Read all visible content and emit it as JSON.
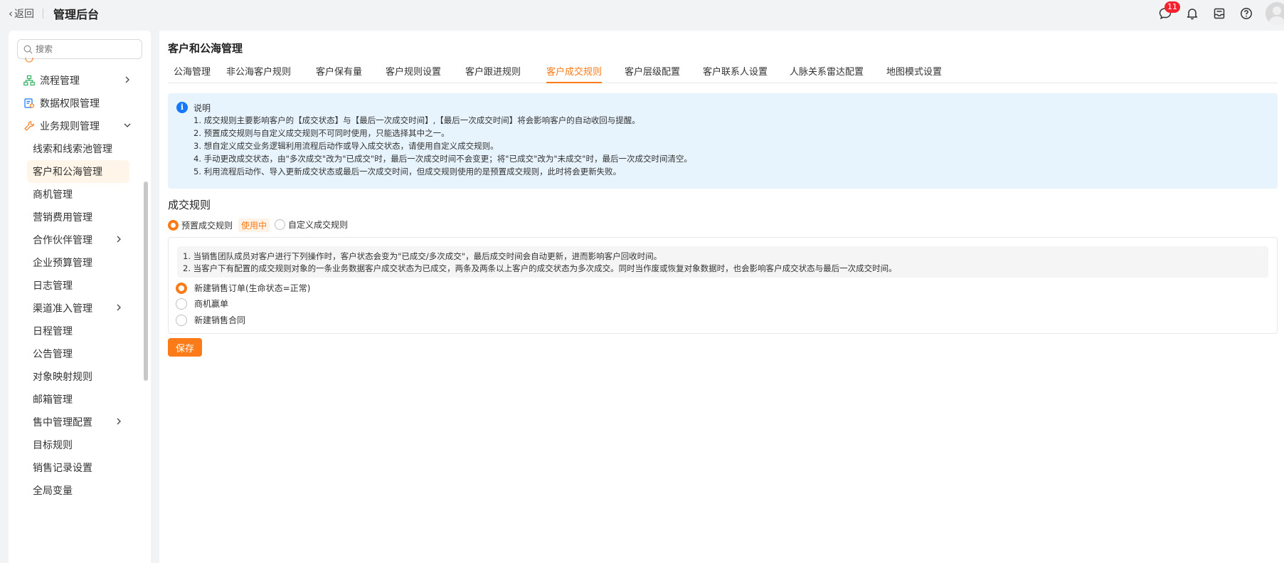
{
  "topbar": {
    "back_label": "返回",
    "app_title": "管理后台",
    "message_badge": "11"
  },
  "sidebar": {
    "search_placeholder": "搜索",
    "items": [
      {
        "label": "流程管理",
        "icon": "flow-icon",
        "level": 1,
        "expandable": true
      },
      {
        "label": "数据权限管理",
        "icon": "data-permission-icon",
        "level": 1,
        "expandable": false
      },
      {
        "label": "业务规则管理",
        "icon": "wrench-icon",
        "level": 1,
        "expandable": true,
        "expanded": true
      },
      {
        "label": "线索和线索池管理",
        "level": 2
      },
      {
        "label": "客户和公海管理",
        "level": 2,
        "active": true
      },
      {
        "label": "商机管理",
        "level": 2
      },
      {
        "label": "营销费用管理",
        "level": 2
      },
      {
        "label": "合作伙伴管理",
        "level": 2,
        "expandable": true
      },
      {
        "label": "企业预算管理",
        "level": 2
      },
      {
        "label": "日志管理",
        "level": 2
      },
      {
        "label": "渠道准入管理",
        "level": 2,
        "expandable": true
      },
      {
        "label": "日程管理",
        "level": 2
      },
      {
        "label": "公告管理",
        "level": 2
      },
      {
        "label": "对象映射规则",
        "level": 2
      },
      {
        "label": "邮箱管理",
        "level": 2
      },
      {
        "label": "售中管理配置",
        "level": 2,
        "expandable": true
      },
      {
        "label": "目标规则",
        "level": 2
      },
      {
        "label": "销售记录设置",
        "level": 2
      },
      {
        "label": "全局变量",
        "level": 2
      }
    ]
  },
  "main": {
    "page_title": "客户和公海管理",
    "tabs": [
      {
        "label": "公海管理"
      },
      {
        "label": "非公海客户规则"
      },
      {
        "label": "客户保有量"
      },
      {
        "label": "客户规则设置"
      },
      {
        "label": "客户跟进规则"
      },
      {
        "label": "客户成交规则",
        "active": true
      },
      {
        "label": "客户层级配置"
      },
      {
        "label": "客户联系人设置"
      },
      {
        "label": "人脉关系雷达配置"
      },
      {
        "label": "地图模式设置"
      }
    ],
    "notice": {
      "title": "说明",
      "lines": [
        "1. 成交规则主要影响客户的【成交状态】与【最后一次成交时间】,【最后一次成交时间】将会影响客户的自动收回与提醒。",
        "2. 预置成交规则与自定义成交规则不可同时使用，只能选择其中之一。",
        "3. 想自定义成交业务逻辑利用流程后动作或导入成交状态，请使用自定义成交规则。",
        "4. 手动更改成交状态，由\"多次成交\"改为\"已成交\"时，最后一次成交时间不会变更；将\"已成交\"改为\"未成交\"时，最后一次成交时间清空。",
        "5. 利用流程后动作、导入更新成交状态或最后一次成交时间，但成交规则使用的是预置成交规则，此时将会更新失败。"
      ]
    },
    "section_title": "成交规则",
    "rule_types": {
      "preset_label": "预置成交规则",
      "in_use_tag": "使用中",
      "custom_label": "自定义成交规则",
      "selected": "preset"
    },
    "rule_box": {
      "desc_lines": [
        "1. 当销售团队成员对客户进行下列操作时，客户状态会变为\"已成交/多次成交\"，最后成交时间会自动更新，进而影响客户回收时间。",
        "2. 当客户下有配置的成交规则对象的一条业务数据客户成交状态为已成交，两条及两条以上客户的成交状态为多次成交。同时当作废或恢复对象数据时，也会影响客户成交状态与最后一次成交时间。"
      ],
      "options": [
        {
          "label": "新建销售订单(生命状态=正常)",
          "checked": true
        },
        {
          "label": "商机赢单",
          "checked": false
        },
        {
          "label": "新建销售合同",
          "checked": false
        }
      ]
    },
    "save_label": "保存"
  },
  "colors": {
    "accent": "#fa7b17",
    "info_blue": "#1677ff",
    "notice_bg": "#e8f4fd",
    "badge_red": "#f5222d"
  }
}
